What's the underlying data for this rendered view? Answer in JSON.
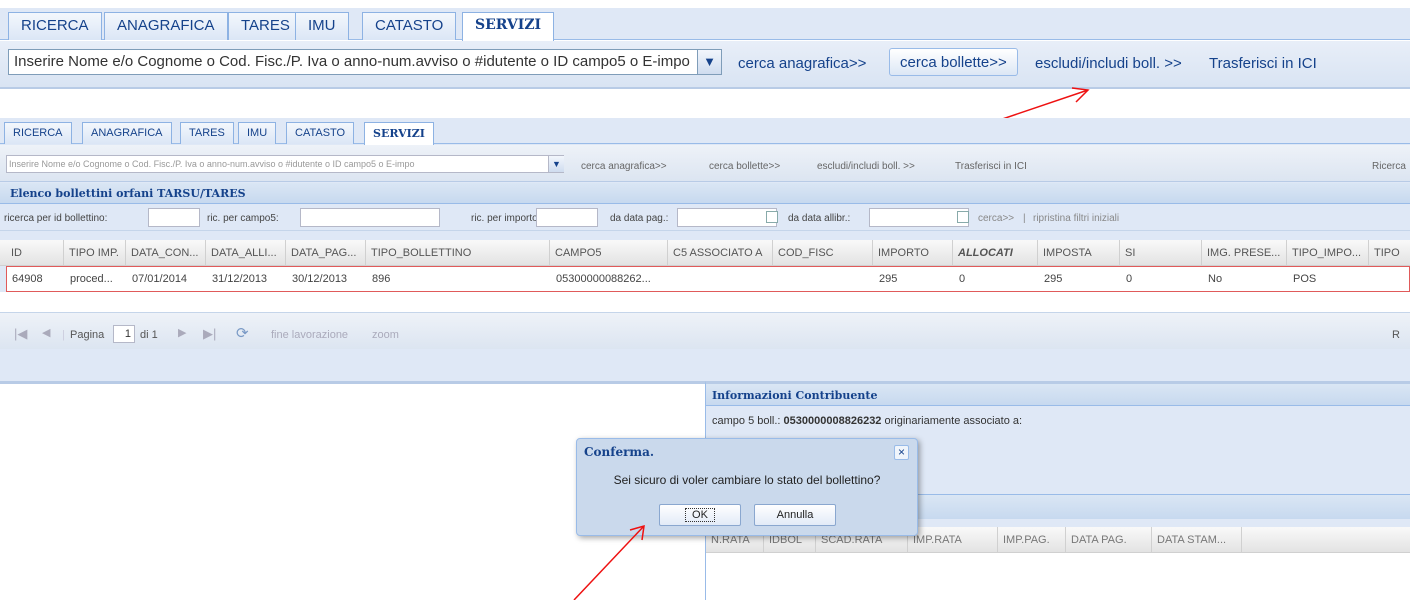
{
  "zoom": {
    "tabs": [
      "RICERCA",
      "ANAGRAFICA",
      "TARES",
      "IMU",
      "CATASTO",
      "SERVIZI"
    ],
    "search_value": "Inserire Nome e/o Cognome o Cod. Fisc./P. Iva o anno-num.avviso o #idutente o ID campo5 o E-impo",
    "cerca_anagrafica": "cerca anagrafica>>",
    "cerca_bollette": "cerca bollette>>",
    "escludi_includi": "escludi/includi boll. >>",
    "trasferisci": "Trasferisci in ICI"
  },
  "tabs": [
    "RICERCA",
    "ANAGRAFICA",
    "TARES",
    "IMU",
    "CATASTO",
    "SERVIZI"
  ],
  "toolbar": {
    "search_value": "Inserire Nome e/o Cognome o Cod. Fisc./P. Iva o anno-num.avviso o #idutente o ID campo5 o E-impo",
    "cerca_anagrafica": "cerca anagrafica>>",
    "cerca_bollette": "cerca bollette>>",
    "escludi_includi": "escludi/includi boll. >>",
    "trasferisci": "Trasferisci in ICI",
    "ricerca": "Ricerca"
  },
  "panel": {
    "title": "Elenco bollettini orfani TARSU/TARES"
  },
  "filters": {
    "id_label": "ricerca per id bollettino:",
    "campo5_label": "ric. per campo5:",
    "importo_label": "ric. per importo:",
    "data_pag_label": "da data pag.:",
    "data_allibr_label": "da data allibr.:",
    "cerca": "cerca>>",
    "sep": "|",
    "ripristina": "ripristina filtri iniziali"
  },
  "grid": {
    "columns": [
      "ID",
      "TIPO IMP.",
      "DATA_CON...",
      "DATA_ALLI...",
      "DATA_PAG...",
      "TIPO_BOLLETTINO",
      "CAMPO5",
      "C5 ASSOCIATO A",
      "COD_FISC",
      "IMPORTO",
      "ALLOCATI",
      "IMPOSTA",
      "SI",
      "IMG. PRESE...",
      "TIPO_IMPO...",
      "TIPO"
    ],
    "row": [
      "64908",
      "proced...",
      "07/01/2014",
      "31/12/2013",
      "30/12/2013",
      "896",
      "05300000088262...",
      "",
      "",
      "295",
      "0",
      "295",
      "0",
      "No",
      "POS",
      ""
    ]
  },
  "pager": {
    "page_label": "Pagina",
    "page_value": "1",
    "of_label": "di 1",
    "fine_lavorazione": "fine lavorazione",
    "zoom": "zoom",
    "right_letter": "R"
  },
  "info": {
    "title": "Informazioni Contribuente",
    "campo5_label": "campo 5 boll.:",
    "campo5_value": "0530000008826232",
    "associated_text": "originariamente associato a:"
  },
  "rate_grid": {
    "columns": [
      "N.RATA",
      "IDBOL",
      "SCAD.RATA",
      "IMP.RATA",
      "IMP.PAG.",
      "DATA PAG.",
      "DATA STAM..."
    ]
  },
  "dialog": {
    "title": "Conferma.",
    "close": "×",
    "message": "Sei sicuro di voler cambiare lo stato del bollettino?",
    "ok": "OK",
    "cancel": "Annulla"
  },
  "colors": {
    "accent": "#15428b",
    "panel_bg": "#dfe8f6",
    "annotation_arrow": "#ee1111",
    "selected_row_border": "#e05a5a"
  },
  "icons": [
    "combo-dropdown-icon",
    "calendar-icon",
    "first-page-icon",
    "prev-page-icon",
    "next-page-icon",
    "last-page-icon",
    "refresh-icon",
    "close-icon"
  ]
}
